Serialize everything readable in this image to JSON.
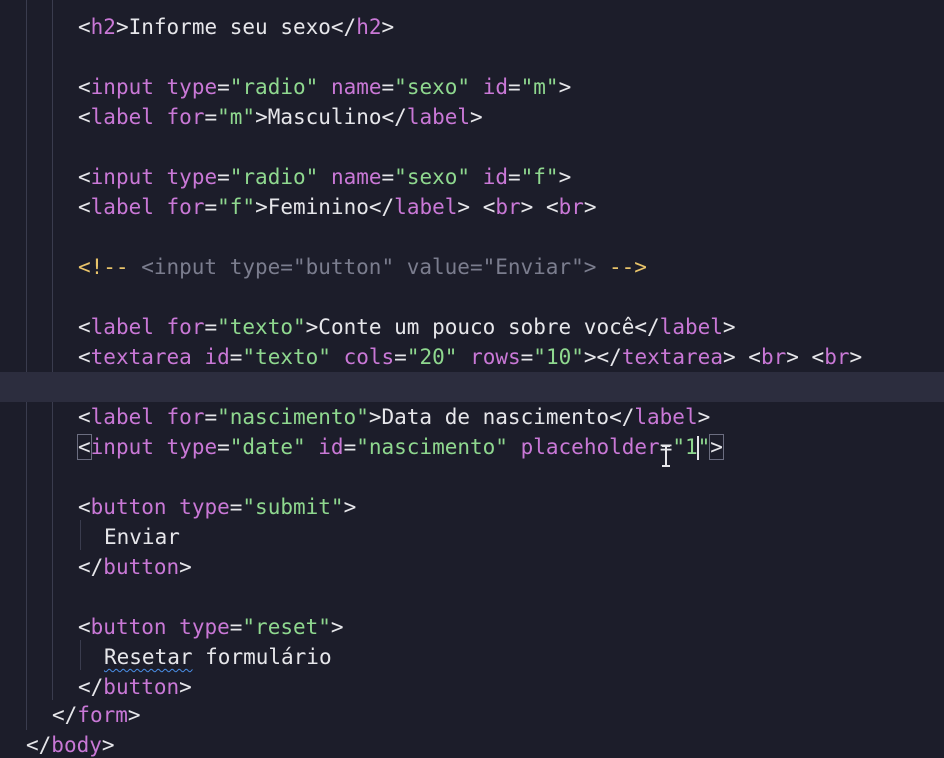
{
  "editor": {
    "language": "html",
    "active_line_index": 12,
    "colors": {
      "background": "#1c1d2a",
      "active_line": "#2c2d3e",
      "tag": "#c978d6",
      "string": "#8fd88f",
      "text": "#e6e6ea",
      "comment": "#7b7d8e",
      "comment_delimiter": "#e9c46a"
    },
    "lines": [
      {
        "tokens": [
          [
            "b",
            "<"
          ],
          [
            "tag",
            "h2"
          ],
          [
            "b",
            ">"
          ],
          [
            "text",
            "Informe seu sexo"
          ],
          [
            "b",
            "</"
          ],
          [
            "tag",
            "h2"
          ],
          [
            "b",
            ">"
          ]
        ]
      },
      {
        "tokens": []
      },
      {
        "tokens": [
          [
            "b",
            "<"
          ],
          [
            "tag",
            "input"
          ],
          [
            "text",
            " "
          ],
          [
            "attr",
            "type"
          ],
          [
            "eq",
            "="
          ],
          [
            "str",
            "\"radio\""
          ],
          [
            "text",
            " "
          ],
          [
            "attr",
            "name"
          ],
          [
            "eq",
            "="
          ],
          [
            "str",
            "\"sexo\""
          ],
          [
            "text",
            " "
          ],
          [
            "attr",
            "id"
          ],
          [
            "eq",
            "="
          ],
          [
            "str",
            "\"m\""
          ],
          [
            "b",
            ">"
          ]
        ]
      },
      {
        "tokens": [
          [
            "b",
            "<"
          ],
          [
            "tag",
            "label"
          ],
          [
            "text",
            " "
          ],
          [
            "attr",
            "for"
          ],
          [
            "eq",
            "="
          ],
          [
            "str",
            "\"m\""
          ],
          [
            "b",
            ">"
          ],
          [
            "text",
            "Masculino"
          ],
          [
            "b",
            "</"
          ],
          [
            "tag",
            "label"
          ],
          [
            "b",
            ">"
          ]
        ]
      },
      {
        "tokens": []
      },
      {
        "tokens": [
          [
            "b",
            "<"
          ],
          [
            "tag",
            "input"
          ],
          [
            "text",
            " "
          ],
          [
            "attr",
            "type"
          ],
          [
            "eq",
            "="
          ],
          [
            "str",
            "\"radio\""
          ],
          [
            "text",
            " "
          ],
          [
            "attr",
            "name"
          ],
          [
            "eq",
            "="
          ],
          [
            "str",
            "\"sexo\""
          ],
          [
            "text",
            " "
          ],
          [
            "attr",
            "id"
          ],
          [
            "eq",
            "="
          ],
          [
            "str",
            "\"f\""
          ],
          [
            "b",
            ">"
          ]
        ]
      },
      {
        "tokens": [
          [
            "b",
            "<"
          ],
          [
            "tag",
            "label"
          ],
          [
            "text",
            " "
          ],
          [
            "attr",
            "for"
          ],
          [
            "eq",
            "="
          ],
          [
            "str",
            "\"f\""
          ],
          [
            "b",
            ">"
          ],
          [
            "text",
            "Feminino"
          ],
          [
            "b",
            "</"
          ],
          [
            "tag",
            "label"
          ],
          [
            "b",
            ">"
          ],
          [
            "text",
            " "
          ],
          [
            "b",
            "<"
          ],
          [
            "tag",
            "br"
          ],
          [
            "b",
            ">"
          ],
          [
            "text",
            " "
          ],
          [
            "b",
            "<"
          ],
          [
            "tag",
            "br"
          ],
          [
            "b",
            ">"
          ]
        ]
      },
      {
        "tokens": []
      },
      {
        "tokens": [
          [
            "cd",
            "<!--"
          ],
          [
            "comment",
            " <input type=\"button\" value=\"Enviar\"> "
          ],
          [
            "cd",
            "-->"
          ]
        ]
      },
      {
        "tokens": []
      },
      {
        "tokens": [
          [
            "b",
            "<"
          ],
          [
            "tag",
            "label"
          ],
          [
            "text",
            " "
          ],
          [
            "attr",
            "for"
          ],
          [
            "eq",
            "="
          ],
          [
            "str",
            "\"texto\""
          ],
          [
            "b",
            ">"
          ],
          [
            "text",
            "Conte um pouco sobre você"
          ],
          [
            "b",
            "</"
          ],
          [
            "tag",
            "label"
          ],
          [
            "b",
            ">"
          ]
        ]
      },
      {
        "tokens": [
          [
            "b",
            "<"
          ],
          [
            "tag",
            "textarea"
          ],
          [
            "text",
            " "
          ],
          [
            "attr",
            "id"
          ],
          [
            "eq",
            "="
          ],
          [
            "str",
            "\"texto\""
          ],
          [
            "text",
            " "
          ],
          [
            "attr",
            "cols"
          ],
          [
            "eq",
            "="
          ],
          [
            "str",
            "\"20\""
          ],
          [
            "text",
            " "
          ],
          [
            "attr",
            "rows"
          ],
          [
            "eq",
            "="
          ],
          [
            "str",
            "\"10\""
          ],
          [
            "b",
            "></"
          ],
          [
            "tag",
            "textarea"
          ],
          [
            "b",
            ">"
          ],
          [
            "text",
            " "
          ],
          [
            "b",
            "<"
          ],
          [
            "tag",
            "br"
          ],
          [
            "b",
            ">"
          ],
          [
            "text",
            " "
          ],
          [
            "b",
            "<"
          ],
          [
            "tag",
            "br"
          ],
          [
            "b",
            ">"
          ]
        ]
      },
      {
        "tokens": []
      },
      {
        "tokens": [
          [
            "b",
            "<"
          ],
          [
            "tag",
            "label"
          ],
          [
            "text",
            " "
          ],
          [
            "attr",
            "for"
          ],
          [
            "eq",
            "="
          ],
          [
            "str",
            "\"nascimento\""
          ],
          [
            "b",
            ">"
          ],
          [
            "text",
            "Data de nascimento"
          ],
          [
            "b",
            "</"
          ],
          [
            "tag",
            "label"
          ],
          [
            "b",
            ">"
          ]
        ]
      },
      {
        "tokens": [
          [
            "bm",
            "<"
          ],
          [
            "tag",
            "input"
          ],
          [
            "text",
            " "
          ],
          [
            "attr",
            "type"
          ],
          [
            "eq",
            "="
          ],
          [
            "str",
            "\"date\""
          ],
          [
            "text",
            " "
          ],
          [
            "attr",
            "id"
          ],
          [
            "eq",
            "="
          ],
          [
            "str",
            "\"nascimento\""
          ],
          [
            "text",
            " "
          ],
          [
            "attr",
            "placeholder"
          ],
          [
            "eq",
            "="
          ],
          [
            "str",
            "\"1"
          ],
          [
            "caret",
            ""
          ],
          [
            "str",
            "\""
          ],
          [
            "bm",
            ">"
          ]
        ]
      },
      {
        "tokens": []
      },
      {
        "tokens": [
          [
            "b",
            "<"
          ],
          [
            "tag",
            "button"
          ],
          [
            "text",
            " "
          ],
          [
            "attr",
            "type"
          ],
          [
            "eq",
            "="
          ],
          [
            "str",
            "\"submit\""
          ],
          [
            "b",
            ">"
          ]
        ]
      },
      {
        "tokens": [
          [
            "text",
            "Enviar"
          ]
        ]
      },
      {
        "tokens": [
          [
            "b",
            "</"
          ],
          [
            "tag",
            "button"
          ],
          [
            "b",
            ">"
          ]
        ]
      },
      {
        "tokens": []
      },
      {
        "tokens": [
          [
            "b",
            "<"
          ],
          [
            "tag",
            "button"
          ],
          [
            "text",
            " "
          ],
          [
            "attr",
            "type"
          ],
          [
            "eq",
            "="
          ],
          [
            "str",
            "\"reset\""
          ],
          [
            "b",
            ">"
          ]
        ]
      },
      {
        "tokens": [
          [
            "sq",
            "Resetar"
          ],
          [
            "text",
            " formulário"
          ]
        ]
      },
      {
        "tokens": [
          [
            "b",
            "</"
          ],
          [
            "tag",
            "button"
          ],
          [
            "b",
            ">"
          ]
        ]
      },
      {
        "tokens": [
          [
            "b",
            "</"
          ],
          [
            "tag",
            "form"
          ],
          [
            "b",
            ">"
          ]
        ]
      },
      {
        "tokens": [
          [
            "b",
            "</"
          ],
          [
            "tag",
            "body"
          ],
          [
            "b",
            ">"
          ]
        ]
      }
    ]
  }
}
